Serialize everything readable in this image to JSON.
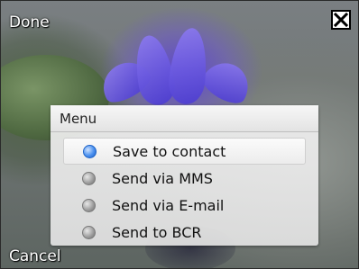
{
  "softkeys": {
    "top_left": "Done",
    "bottom_left": "Cancel"
  },
  "menu": {
    "title": "Menu",
    "items": [
      {
        "label": "Save to contact",
        "selected": true
      },
      {
        "label": "Send via MMS",
        "selected": false
      },
      {
        "label": "Send via E-mail",
        "selected": false
      },
      {
        "label": "Send to BCR",
        "selected": false
      }
    ]
  },
  "icons": {
    "close": "close-icon",
    "radio_on": "radio-selected-icon",
    "radio_off": "radio-unselected-icon"
  },
  "colors": {
    "radio_selected": "#4a90ef",
    "radio_unselected": "#9a9a9a",
    "menu_background": "#e6e6e6"
  }
}
